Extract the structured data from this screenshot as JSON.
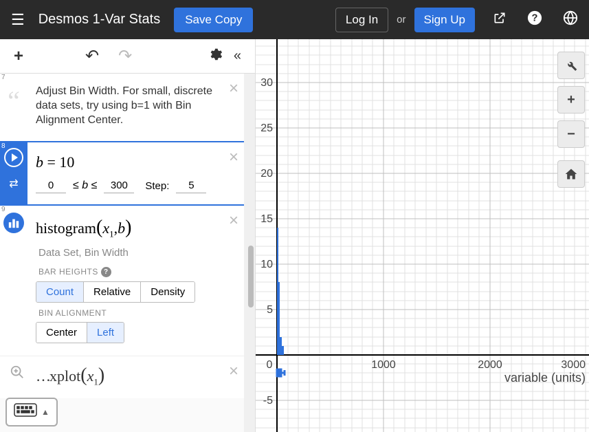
{
  "header": {
    "title": "Desmos 1-Var Stats",
    "save": "Save Copy",
    "login": "Log In",
    "or": "or",
    "signup": "Sign Up"
  },
  "expressions": {
    "note7": {
      "index": "7",
      "text": "Adjust Bin Width.  For small, discrete data sets, try using b=1 with Bin Alignment Center."
    },
    "slider8": {
      "index": "8",
      "formula": "b = 10",
      "min": "0",
      "max": "300",
      "step_label": "Step:",
      "step": "5"
    },
    "hist9": {
      "index": "9",
      "formula_prefix": "histogram",
      "formula_args": "(x₁,b)",
      "caption": "Data Set, Bin Width",
      "bar_heights_label": "BAR HEIGHTS",
      "bar_opts": [
        "Count",
        "Relative",
        "Density"
      ],
      "bar_selected": 0,
      "align_label": "BIN ALIGNMENT",
      "align_opts": [
        "Center",
        "Left"
      ],
      "align_selected": 1
    },
    "box10": {
      "formula": "…plot(x₁)"
    }
  },
  "graph": {
    "y_ticks": [
      "30",
      "25",
      "20",
      "15",
      "10",
      "5",
      "-5"
    ],
    "x_ticks": [
      "0",
      "1000",
      "2000",
      "3000"
    ],
    "x_label": "variable (units)"
  },
  "chart_data": {
    "type": "bar",
    "title": "",
    "xlabel": "variable (units)",
    "ylabel": "",
    "xlim": [
      0,
      3000
    ],
    "ylim": [
      -5,
      32
    ],
    "series": [
      {
        "name": "histogram",
        "bin_width": 10,
        "categories": [
          5,
          15,
          25,
          35
        ],
        "values": [
          14,
          8,
          2,
          1
        ]
      }
    ],
    "boxplot": {
      "y": -2,
      "min": 0,
      "q1": 5,
      "median": 10,
      "q3": 30,
      "max": 60
    }
  }
}
